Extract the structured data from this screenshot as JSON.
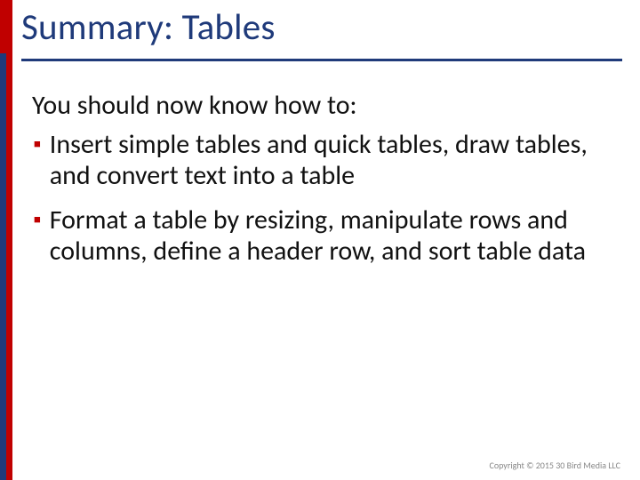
{
  "title": "Summary: Tables",
  "intro": "You should now know how to:",
  "bullets": [
    "Insert simple tables and quick tables, draw tables, and convert text into a table",
    "Format a table by resizing, manipulate rows and columns, define a header row, and sort table data"
  ],
  "footer": "Copyright © 2015 30 Bird Media LLC",
  "bullet_glyph": "▪",
  "colors": {
    "accent_red": "#c00000",
    "accent_navy": "#1f3a7a"
  }
}
